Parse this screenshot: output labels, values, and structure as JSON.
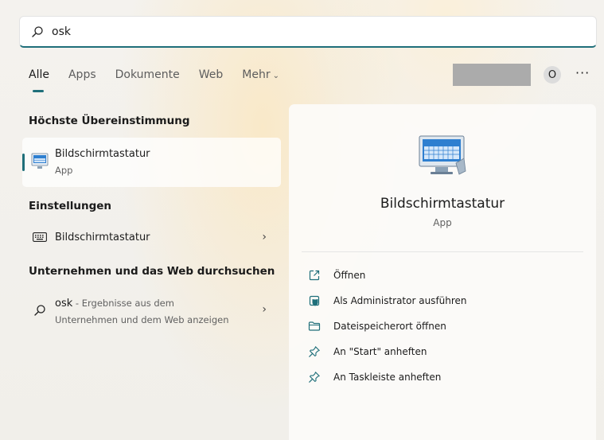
{
  "search": {
    "value": "osk"
  },
  "tabs": [
    {
      "label": "Alle",
      "active": true
    },
    {
      "label": "Apps"
    },
    {
      "label": "Dokumente"
    },
    {
      "label": "Web"
    },
    {
      "label": "Mehr"
    }
  ],
  "account": {
    "avatar_letter": "O",
    "more_label": "···"
  },
  "best_match": {
    "section_title": "Höchste Übereinstimmung",
    "name": "Bildschirmtastatur",
    "type": "App"
  },
  "settings": {
    "section_title": "Einstellungen",
    "item": "Bildschirmtastatur"
  },
  "web": {
    "section_title": "Unternehmen und das Web durchsuchen",
    "query": "osk",
    "suffix": " - Ergebnisse aus dem",
    "line2": "Unternehmen und dem Web anzeigen"
  },
  "detail": {
    "name": "Bildschirmtastatur",
    "type": "App",
    "actions": [
      {
        "label": "Öffnen",
        "icon": "open-icon"
      },
      {
        "label": "Als Administrator ausführen",
        "icon": "shield-icon"
      },
      {
        "label": "Dateispeicherort öffnen",
        "icon": "folder-icon"
      },
      {
        "label": "An \"Start\" anheften",
        "icon": "pin-icon"
      },
      {
        "label": "An Taskleiste anheften",
        "icon": "pin-icon"
      }
    ]
  },
  "colors": {
    "accent": "#1f6f7a",
    "account_placeholder": "#ababab"
  }
}
